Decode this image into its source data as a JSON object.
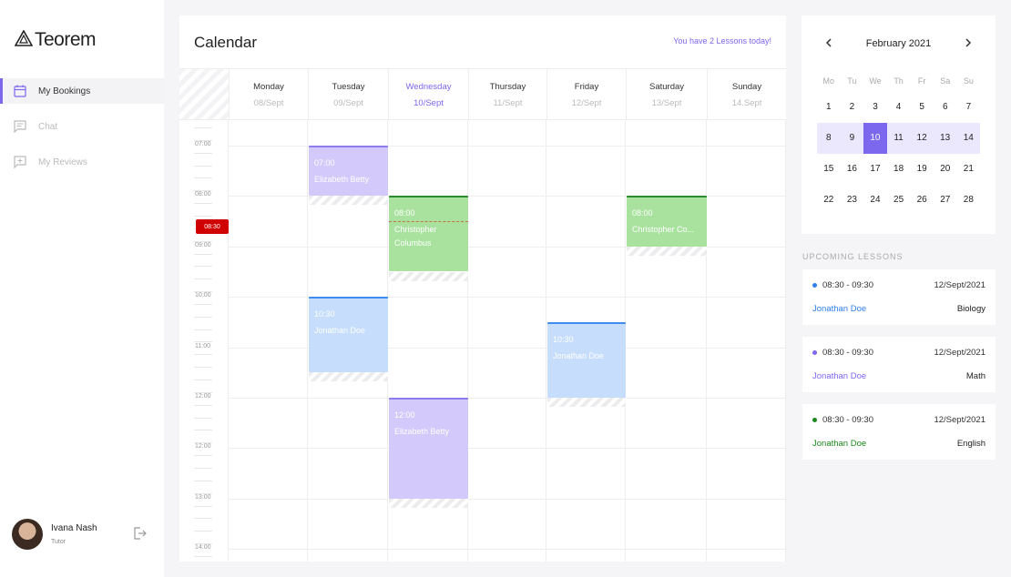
{
  "app": {
    "logo_text": "Teorem"
  },
  "sidebar": {
    "items": [
      {
        "label": "My Bookings",
        "icon": "calendar-icon",
        "active": true
      },
      {
        "label": "Chat",
        "icon": "chat-icon",
        "active": false
      },
      {
        "label": "My Reviews",
        "icon": "review-icon",
        "active": false
      }
    ],
    "user": {
      "name": "Ivana Nash",
      "role": "Tutor"
    }
  },
  "calendar": {
    "title": "Calendar",
    "notice": "You have 2 Lessons today!",
    "days": [
      {
        "name": "Monday",
        "date": "08/Sept"
      },
      {
        "name": "Tuesday",
        "date": "09/Sept"
      },
      {
        "name": "Wednesday",
        "date": "10/Sept"
      },
      {
        "name": "Thursday",
        "date": "11/Sept"
      },
      {
        "name": "Friday",
        "date": "12/Sept"
      },
      {
        "name": "Saturday",
        "date": "13/Sept"
      },
      {
        "name": "Sunday",
        "date": "14.Sept"
      }
    ],
    "today_index": 2,
    "hours": [
      "07:00",
      "08:00",
      "09:00",
      "10:00",
      "11:00",
      "12:00",
      "12:00",
      "13:00",
      "14:00"
    ],
    "now_label": "08:30",
    "events": [
      {
        "time": "07:00",
        "name": "Elizabeth Betty",
        "color": "purple"
      },
      {
        "time": "08:00",
        "name": "Christopher Columbus",
        "color": "green"
      },
      {
        "time": "08:00",
        "name": "Christopher  Co...",
        "color": "green"
      },
      {
        "time": "10:30",
        "name": "Jonathan Doe",
        "color": "blue"
      },
      {
        "time": "10:30",
        "name": "Jonathan Doe",
        "color": "blue"
      },
      {
        "time": "12:00",
        "name": "Elizabeth Betty",
        "color": "purple"
      }
    ]
  },
  "mini_calendar": {
    "month": "February 2021",
    "weekdays": [
      "Mo",
      "Tu",
      "We",
      "Th",
      "Fr",
      "Sa",
      "Su"
    ],
    "weeks": [
      [
        "1",
        "2",
        "3",
        "4",
        "5",
        "6",
        "7"
      ],
      [
        "8",
        "9",
        "10",
        "11",
        "12",
        "13",
        "14"
      ],
      [
        "15",
        "16",
        "17",
        "18",
        "19",
        "20",
        "21"
      ],
      [
        "22",
        "23",
        "24",
        "25",
        "26",
        "27",
        "28"
      ]
    ],
    "selected_day": "10"
  },
  "upcoming": {
    "title": "UPCOMING LESSONS",
    "lessons": [
      {
        "time": "08:30 - 09:30",
        "date": "12/Sept/2021",
        "name": "Jonathan Doe",
        "subject": "Biology",
        "color": "#2f80ed"
      },
      {
        "time": "08:30 - 09:30",
        "date": "12/Sept/2021",
        "name": "Jonathan Doe",
        "subject": "Math",
        "color": "#7b68ee"
      },
      {
        "time": "08:30 - 09:30",
        "date": "12/Sept/2021",
        "name": "Jonathan Doe",
        "subject": "English",
        "color": "#1e8a1e"
      }
    ]
  },
  "colors": {
    "accent": "#7b68ee",
    "now": "#d10000"
  }
}
